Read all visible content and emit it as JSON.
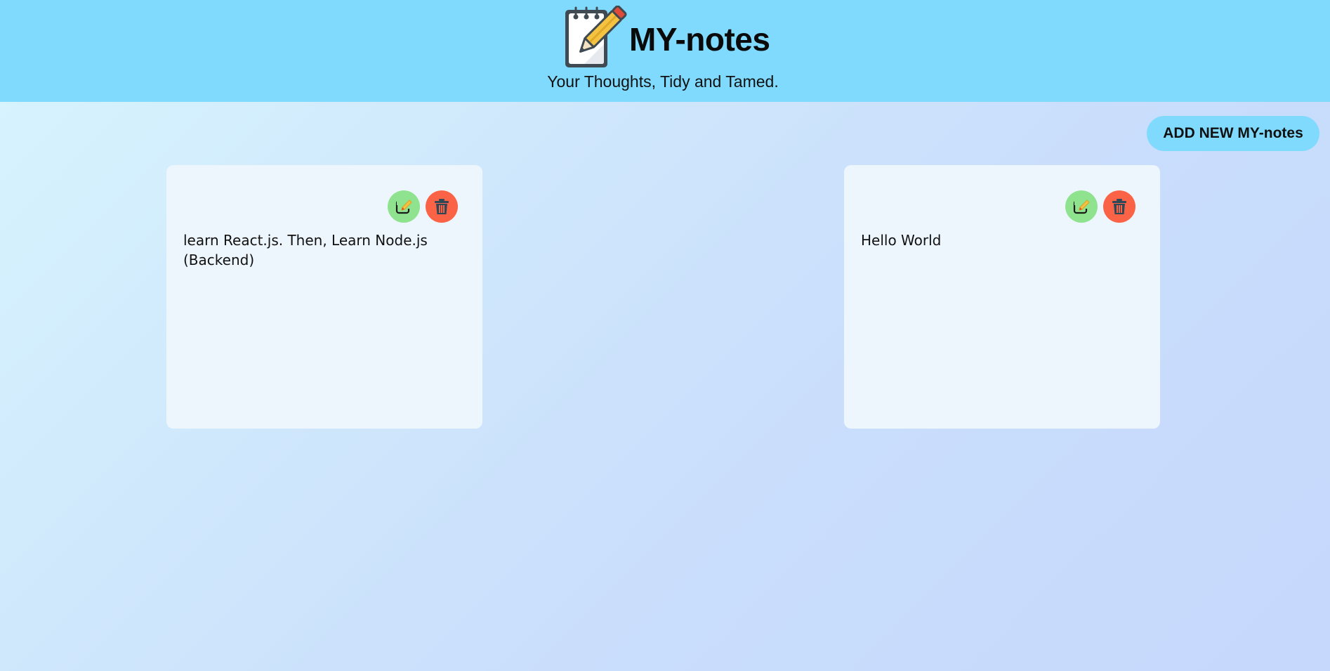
{
  "header": {
    "title": "MY-notes",
    "tagline": "Your Thoughts, Tidy and Tamed.",
    "logo_icon": "notepad-pencil-icon"
  },
  "actions": {
    "add_label": "ADD NEW MY-notes"
  },
  "notes": [
    {
      "text": "learn React.js. Then, Learn Node.js (Backend)"
    },
    {
      "text": "Hello World"
    }
  ],
  "colors": {
    "header_bg": "#80dafd",
    "edit_bg": "#8fe38f",
    "delete_bg": "#fb6347",
    "card_bg": "#eef6fd"
  },
  "icons": {
    "edit": "edit-icon",
    "delete": "trash-icon"
  }
}
